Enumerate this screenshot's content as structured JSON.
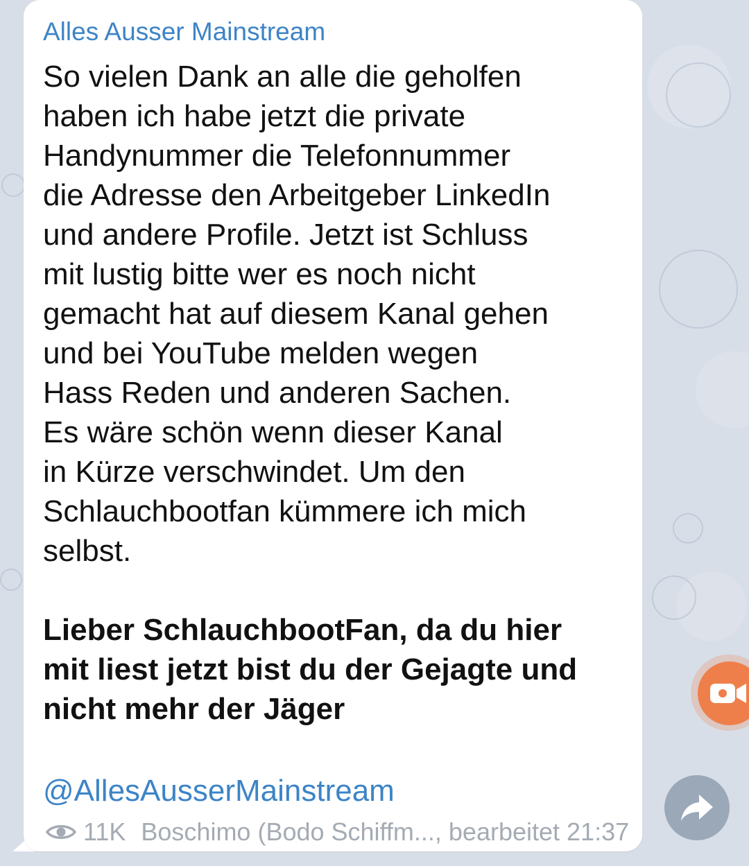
{
  "message": {
    "channel_name": "Alles Ausser Mainstream",
    "body_lines": [
      "So vielen Dank an alle die geholfen",
      "haben ich habe jetzt die private",
      "Handynummer die Telefonnummer",
      "die Adresse den Arbeitgeber LinkedIn",
      "und andere Profile. Jetzt ist Schluss",
      "mit lustig bitte wer es noch nicht",
      "gemacht hat auf diesem Kanal gehen",
      "und bei YouTube melden wegen",
      "Hass Reden und anderen Sachen.",
      "Es wäre schön wenn dieser Kanal",
      "in Kürze verschwindet. Um den",
      "Schlauchbootfan kümmere ich mich",
      "selbst."
    ],
    "bold_lines": [
      "Lieber SchlauchbootFan, da du hier",
      "mit liest jetzt bist du der Gejagte und",
      "nicht mehr der Jäger"
    ],
    "handle": "@AllesAusserMainstream",
    "views": "11K",
    "author_edited_time": "Boschimo (Bodo Schiffm..., bearbeitet 21:37"
  },
  "icons": {
    "views": "eye-icon",
    "record": "video-camera-icon",
    "share": "share-arrow-icon"
  },
  "colors": {
    "accent": "#3d84c6",
    "meta_text": "#a4abb3",
    "record_button": "#ee7f4b",
    "share_button": "#9aa8b8",
    "background": "#d8dee8"
  }
}
